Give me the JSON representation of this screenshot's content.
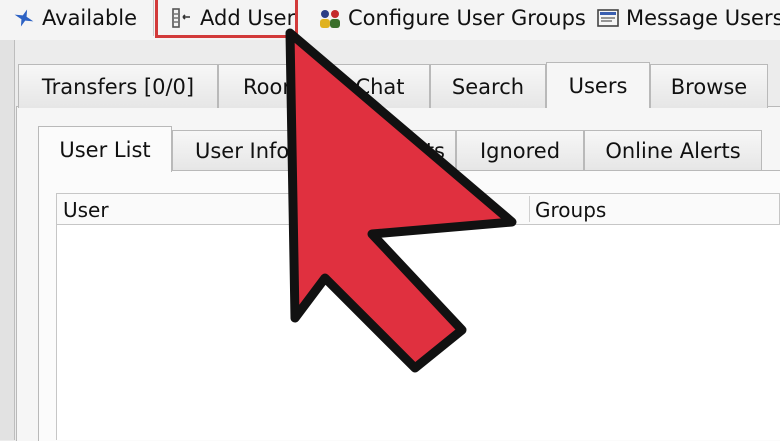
{
  "toolbar": {
    "available_label": "Available",
    "add_user_label": "Add User",
    "configure_groups_label": "Configure User Groups",
    "message_users_label": "Message Users"
  },
  "main_tabs": [
    {
      "label": "Transfers [0/0]"
    },
    {
      "label": "Rooms"
    },
    {
      "label": "Chat"
    },
    {
      "label": "Search"
    },
    {
      "label": "Users"
    },
    {
      "label": "Browse"
    }
  ],
  "sub_tabs": [
    {
      "label": "User List"
    },
    {
      "label": "User Info"
    },
    {
      "label": "Interests"
    },
    {
      "label": "Ignored"
    },
    {
      "label": "Online Alerts"
    }
  ],
  "user_table": {
    "columns": [
      "User",
      "Groups"
    ]
  },
  "colors": {
    "highlight_box": "#d23a3a",
    "cursor_fill": "#e0303f",
    "cursor_outline": "#111111"
  },
  "icons": {
    "available": "plane-icon",
    "add_user": "add-user-icon",
    "configure_groups": "user-groups-icon",
    "message_users": "message-icon",
    "pointer": "arrow-cursor-icon"
  }
}
